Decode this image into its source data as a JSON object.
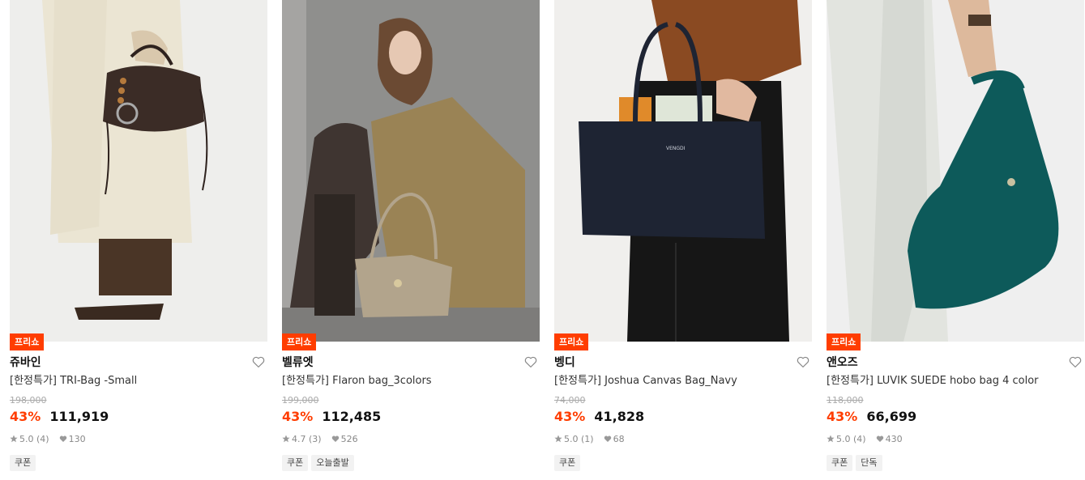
{
  "products": [
    {
      "badge": "프리쇼",
      "brand": "쥬바인",
      "name": "[한정특가] TRI-Bag -Small",
      "original_price": "198,000",
      "discount": "43%",
      "price": "111,919",
      "rating": "5.0 (4)",
      "likes": "130",
      "tags": [
        "쿠폰"
      ]
    },
    {
      "badge": "프리쇼",
      "brand": "벨류엣",
      "name": "[한정특가] Flaron bag_3colors",
      "original_price": "199,000",
      "discount": "43%",
      "price": "112,485",
      "rating": "4.7 (3)",
      "likes": "526",
      "tags": [
        "쿠폰",
        "오늘출발"
      ]
    },
    {
      "badge": "프리쇼",
      "brand": "벵디",
      "name": "[한정특가] Joshua Canvas Bag_Navy",
      "original_price": "74,000",
      "discount": "43%",
      "price": "41,828",
      "rating": "5.0 (1)",
      "likes": "68",
      "tags": [
        "쿠폰"
      ]
    },
    {
      "badge": "프리쇼",
      "brand": "앤오즈",
      "name": "[한정특가] LUVIK SUEDE hobo bag 4 color",
      "original_price": "118,000",
      "discount": "43%",
      "price": "66,699",
      "rating": "5.0 (4)",
      "likes": "430",
      "tags": [
        "쿠폰",
        "단독"
      ]
    }
  ],
  "icons": {
    "wishlist": "heart-outline-icon",
    "rating": "star-icon",
    "likes": "heart-filled-icon"
  },
  "colors": {
    "accent": "#ff3d00",
    "tag_bg": "#f2f2f2"
  }
}
